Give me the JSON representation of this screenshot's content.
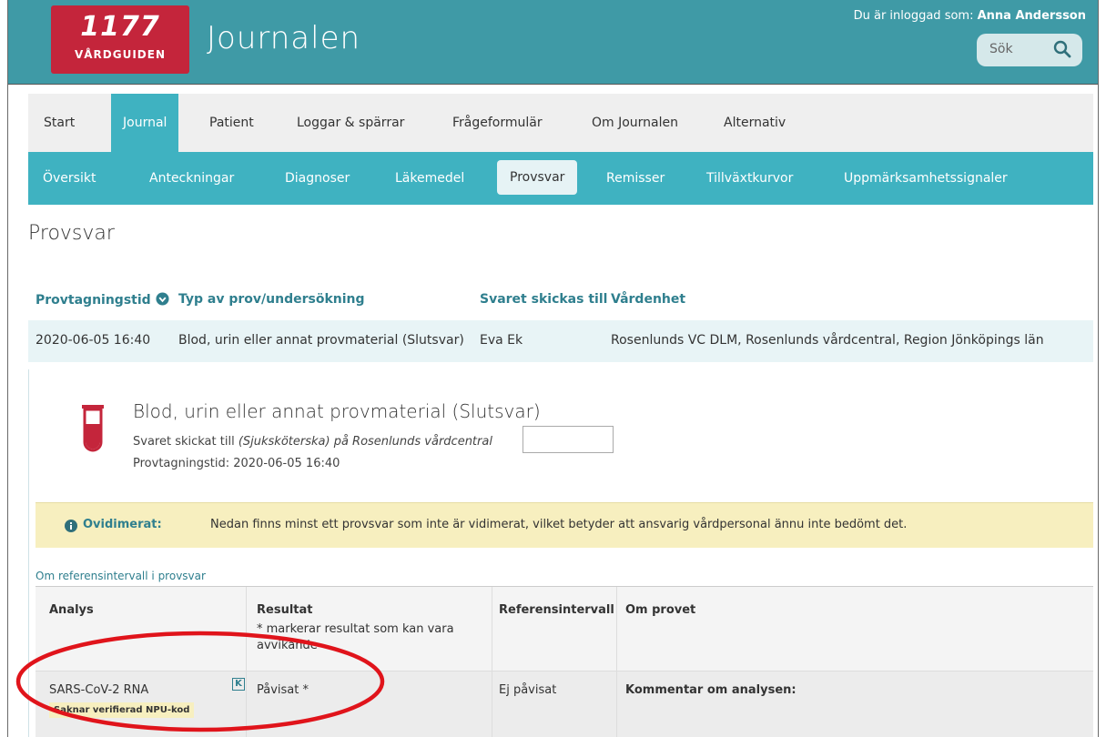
{
  "header": {
    "logo_number": "1177",
    "logo_sub": "VÅRDGUIDEN",
    "app_title": "Journalen",
    "login_prefix": "Du är inloggad som:",
    "login_user": "Anna Andersson",
    "search_label": "Sök"
  },
  "nav_primary": [
    "Start",
    "Journal",
    "Patient",
    "Loggar & spärrar",
    "Frågeformulär",
    "Om Journalen",
    "Alternativ"
  ],
  "nav_primary_active": "Journal",
  "nav_secondary": [
    "Översikt",
    "Anteckningar",
    "Diagnoser",
    "Läkemedel",
    "Provsvar",
    "Remisser",
    "Tillväxtkurvor",
    "Uppmärksamhetssignaler"
  ],
  "nav_secondary_active": "Provsvar",
  "page_title": "Provsvar",
  "results_table": {
    "headers": [
      "Provtagningstid",
      "Typ av prov/undersökning",
      "Svaret skickas till",
      "Vårdenhet"
    ],
    "row": [
      "2020-06-05 16:40",
      "Blod, urin eller annat provmaterial (Slutsvar)",
      "Eva Ek",
      "Rosenlunds VC DLM, Rosenlunds vårdcentral, Region Jönköpings län"
    ]
  },
  "detail": {
    "title": "Blod, urin eller annat provmaterial (Slutsvar)",
    "sent_prefix": "Svaret skickat till",
    "sent_role": "(Sjuksköterska) på Rosenlunds vårdcentral",
    "time_label": "Provtagningstid:",
    "time_value": "2020-06-05 16:40"
  },
  "warning": {
    "label": "Ovidimerat:",
    "text": "Nedan finns minst ett provsvar som inte är vidimerat, vilket betyder att ansvarig vårdpersonal ännu inte bedömt det."
  },
  "ref_link": "Om referensintervall i provsvar",
  "analysis_table": {
    "headers": [
      "Analys",
      "Resultat",
      "Referensintervall",
      "Om provet"
    ],
    "result_note": "* markerar resultat som kan vara avvikande",
    "row": {
      "analys": "SARS-CoV-2 RNA",
      "k_label": "K",
      "badge": "Saknar verifierad NPU-kod",
      "resultat": "Påvisat *",
      "referens": "Ej påvisat",
      "om_provet": "Kommentar om analysen:"
    }
  },
  "colors": {
    "header_teal": "#3f9aa6",
    "nav_teal": "#3fb2c1",
    "logo_red": "#c4253b",
    "link_teal": "#2f7f8e",
    "warning_bg": "#f7efbf",
    "annotation_red": "#e0141b"
  }
}
